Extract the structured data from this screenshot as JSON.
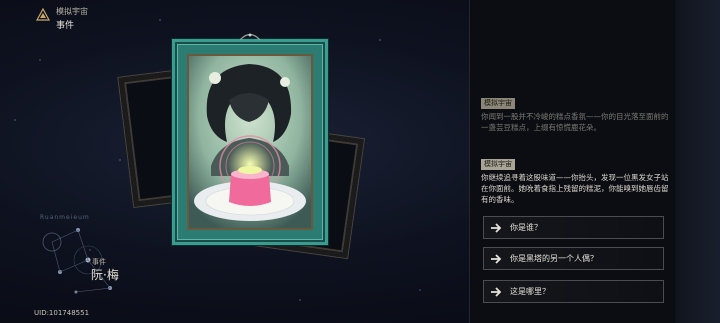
{
  "header": {
    "section": "模拟宇宙",
    "title": "事件"
  },
  "character": {
    "label": "事件",
    "name": "阮·梅",
    "constellation_word": "Ruanmeieum"
  },
  "uid": "UID:101748551",
  "log": [
    {
      "tag": "模拟宇宙",
      "text": "你闻到一股并不冷峻的糕点香氛——你的目光落至面前的一盏芸豆糕点，上缀有惊慌鹿花朵。"
    },
    {
      "tag": "模拟宇宙",
      "text": "你继续追寻着这股味道——你抬头，发现一位黑发女子站在你面前。她吮着食指上残留的糕泥，你能嗅到她唇齿留有的香味。"
    }
  ],
  "options": [
    {
      "label": "你是谁？"
    },
    {
      "label": "你是黑塔的另一个人偶？"
    },
    {
      "label": "这是哪里？"
    }
  ],
  "colors": {
    "frame": "#2d7c74",
    "accent": "#c9a86a",
    "panel": "#0b0d12"
  }
}
